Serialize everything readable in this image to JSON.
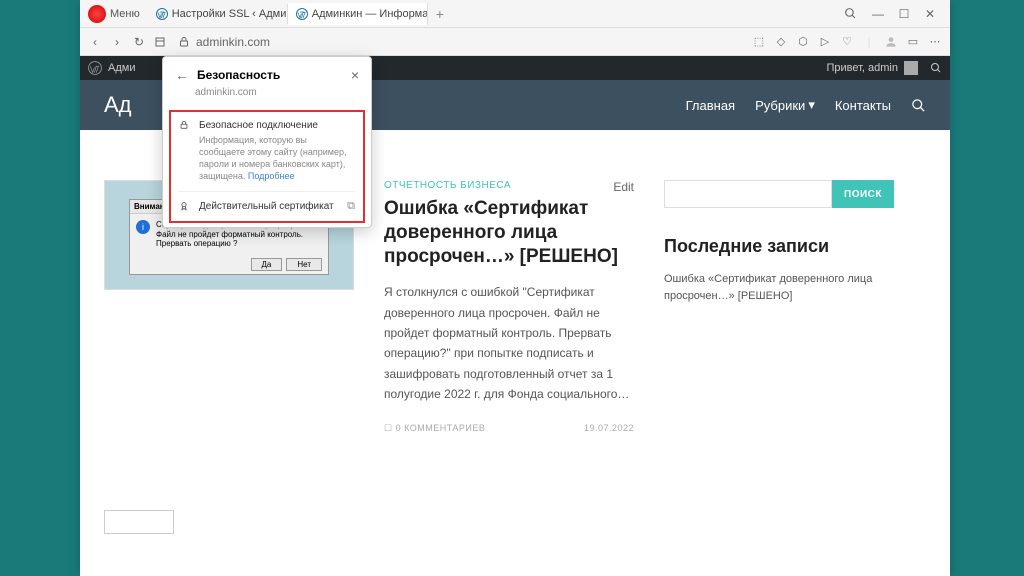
{
  "browser": {
    "menu_label": "Меню",
    "tabs": [
      {
        "title": "Настройки SSL ‹ Админки",
        "active": false
      },
      {
        "title": "Админкин — Информаци",
        "active": true
      }
    ],
    "url": "adminkin.com",
    "win": {
      "search": "⌕",
      "min": "—",
      "max": "☐",
      "close": "✕"
    }
  },
  "wp_bar": {
    "left_label": "Адми",
    "greeting": "Привет, admin"
  },
  "site": {
    "logo": "Ад",
    "nav": {
      "home": "Главная",
      "rubrics": "Рубрики",
      "contacts": "Контакты"
    }
  },
  "security_popup": {
    "title": "Безопасность",
    "domain": "adminkin.com",
    "secure_title": "Безопасное подключение",
    "secure_text": "Информация, которую вы сообщаете этому сайту (например, пароли и номера банковских карт), защищена. ",
    "learn_more": "Подробнее",
    "cert_label": "Действительный сертификат"
  },
  "thumbnail_dialog": {
    "title": "Внимание",
    "text": "Сертификат доверенного лица просрочен. Файл не пройдет форматный контроль. Прервать операцию ?",
    "yes": "Да",
    "no": "Нет"
  },
  "post": {
    "category": "ОТЧЕТНОСТЬ БИЗНЕСА",
    "edit": "Edit",
    "title": "Ошибка «Сертификат доверенного лица просрочен…» [РЕШЕНО]",
    "excerpt": "Я столкнулся с ошибкой \"Сертификат доверенного лица просрочен. Файл не пройдет форматный контроль. Прервать операцию?\" при попытке подписать и зашифровать подготовленный отчет за 1 полугодие 2022 г. для Фонда социального…",
    "comments": "0 КОММЕНТАРИЕВ",
    "date": "19.07.2022"
  },
  "sidebar": {
    "search_btn": "ПОИСК",
    "recent_title": "Последние записи",
    "recent_post": "Ошибка «Сертификат доверенного лица просрочен…» [РЕШЕНО]"
  }
}
